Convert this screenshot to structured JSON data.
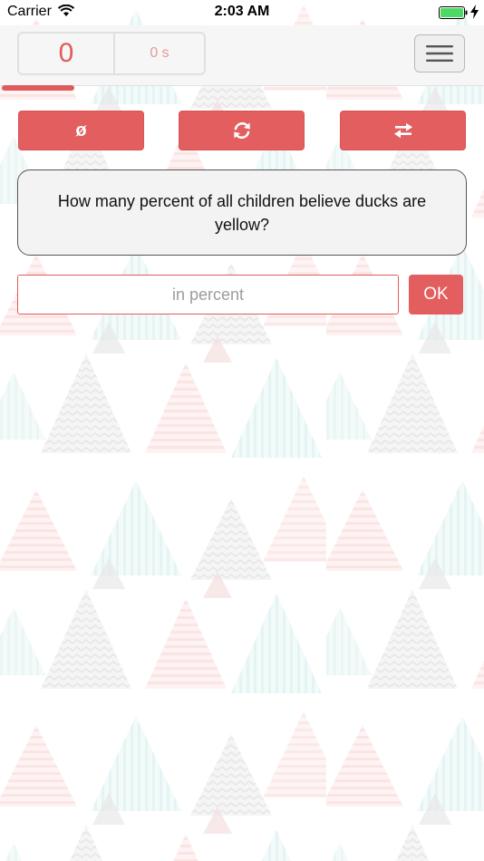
{
  "status_bar": {
    "carrier": "Carrier",
    "time": "2:03 AM",
    "wifi_icon": "wifi-icon",
    "battery_icon": "battery-full-icon",
    "charging_icon": "charging-bolt-icon"
  },
  "header": {
    "score": "0",
    "time": "0 s",
    "menu_icon": "hamburger-menu-icon",
    "progress_fraction": 0.15
  },
  "actions": {
    "null_label": "ø",
    "refresh_icon": "refresh-icon",
    "swap_icon": "swap-arrows-icon"
  },
  "question": {
    "text": "How many percent of all children believe ducks are yellow?"
  },
  "answer": {
    "value": "",
    "placeholder": "in percent",
    "submit_label": "OK"
  },
  "colors": {
    "accent": "#e35e5f",
    "score_text": "#e05c5c",
    "card_background": "#f3f3f3",
    "header_background": "#f6f6f6"
  }
}
